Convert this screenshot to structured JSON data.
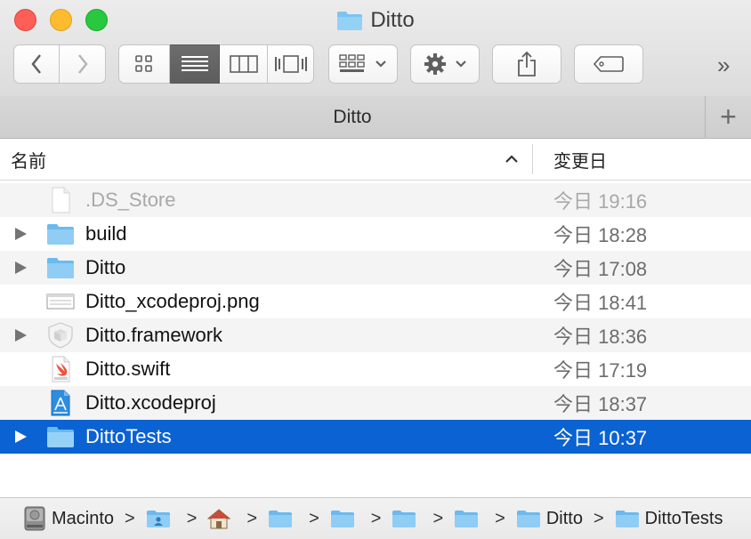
{
  "window": {
    "title": "Ditto"
  },
  "toolbar": {
    "back_icon": "chevron-left-icon",
    "forward_icon": "chevron-right-icon",
    "views": [
      "icon-view-icon",
      "list-view-icon",
      "column-view-icon",
      "gallery-view-icon"
    ],
    "active_view": "list-view-icon",
    "arrange_icon": "arrange-grid-icon",
    "action_icon": "gear-icon",
    "share_icon": "share-icon",
    "tag_icon": "tag-icon",
    "overflow_label": "»"
  },
  "tab": {
    "title": "Ditto",
    "add_label": "+"
  },
  "columns": {
    "name": "名前",
    "date": "変更日"
  },
  "files": [
    {
      "name": ".DS_Store",
      "date": "今日 19:16",
      "icon": "document-icon",
      "expandable": false,
      "dim": true,
      "selected": false
    },
    {
      "name": "build",
      "date": "今日 18:28",
      "icon": "folder-icon",
      "expandable": true,
      "dim": false,
      "selected": false
    },
    {
      "name": "Ditto",
      "date": "今日 17:08",
      "icon": "folder-icon",
      "expandable": true,
      "dim": false,
      "selected": false
    },
    {
      "name": "Ditto_xcodeproj.png",
      "date": "今日 18:41",
      "icon": "image-file-icon",
      "expandable": false,
      "dim": false,
      "selected": false
    },
    {
      "name": "Ditto.framework",
      "date": "今日 18:36",
      "icon": "framework-icon",
      "expandable": true,
      "dim": false,
      "selected": false
    },
    {
      "name": "Ditto.swift",
      "date": "今日 17:19",
      "icon": "swift-file-icon",
      "expandable": false,
      "dim": false,
      "selected": false
    },
    {
      "name": "Ditto.xcodeproj",
      "date": "今日 18:37",
      "icon": "xcodeproj-icon",
      "expandable": false,
      "dim": false,
      "selected": false
    },
    {
      "name": "DittoTests",
      "date": "今日 10:37",
      "icon": "folder-icon",
      "expandable": true,
      "dim": false,
      "selected": true
    }
  ],
  "pathbar": [
    {
      "label": "Macinto",
      "icon": "hard-drive-icon"
    },
    {
      "label": "",
      "icon": "user-folder-icon"
    },
    {
      "label": "",
      "icon": "home-icon"
    },
    {
      "label": "",
      "icon": "folder-icon"
    },
    {
      "label": "",
      "icon": "folder-icon"
    },
    {
      "label": "",
      "icon": "folder-icon"
    },
    {
      "label": "",
      "icon": "folder-icon"
    },
    {
      "label": "Ditto",
      "icon": "folder-icon"
    },
    {
      "label": "DittoTests",
      "icon": "folder-icon"
    }
  ],
  "path_separator": ">",
  "colors": {
    "selection": "#0b62d2",
    "folder": "#7cc4f2",
    "close": "#fd5f57",
    "minimize": "#febb2e",
    "maximize": "#28c840"
  }
}
